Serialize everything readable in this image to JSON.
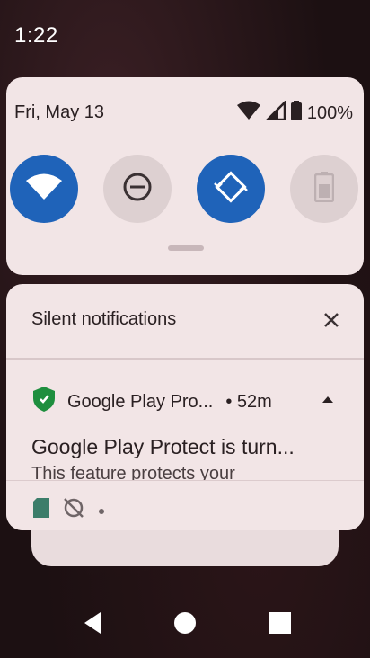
{
  "status_bar": {
    "time": "1:22"
  },
  "quick_settings": {
    "date": "Fri, May 13",
    "battery": "100%",
    "tiles": [
      {
        "name": "wifi",
        "state": "on"
      },
      {
        "name": "do-not-disturb",
        "state": "off"
      },
      {
        "name": "auto-rotate",
        "state": "on"
      },
      {
        "name": "battery-saver",
        "state": "off"
      }
    ]
  },
  "notifications": {
    "header": "Silent notifications",
    "items": [
      {
        "app": "Google Play Pro...",
        "time": "• 52m",
        "title": "Google Play Protect is turn...",
        "body": "This feature protects your"
      }
    ]
  },
  "colors": {
    "accent": "#1f63b9",
    "panel": "#f2e5e6"
  }
}
